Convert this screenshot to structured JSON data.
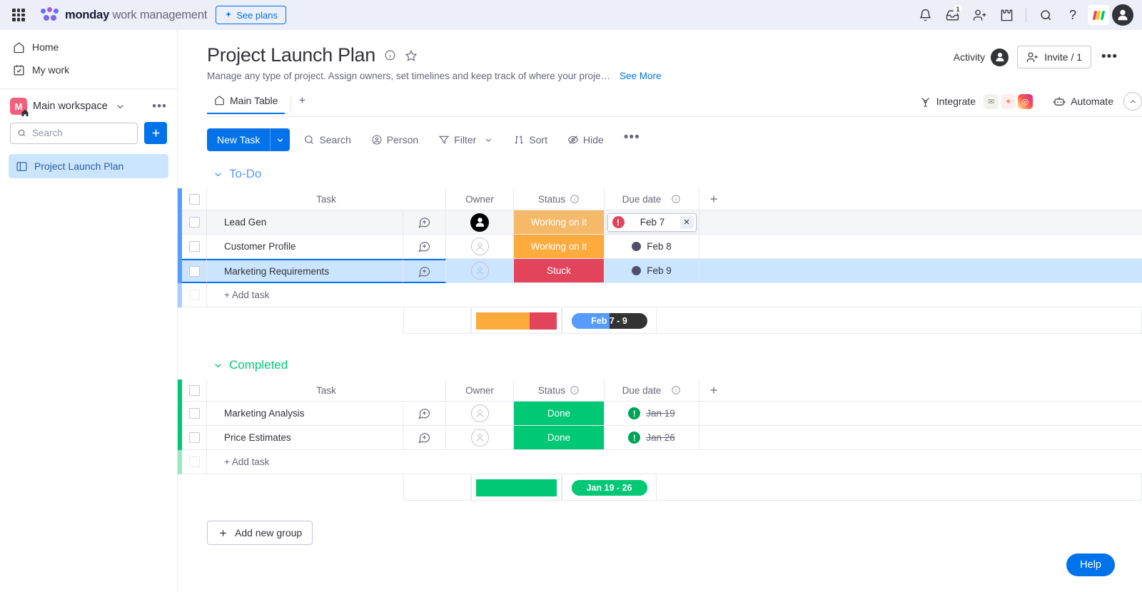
{
  "topbar": {
    "brand_bold": "monday",
    "brand_light": " work management",
    "see_plans": "See plans",
    "inbox_badge": "1",
    "icons": [
      "apps-grid-icon",
      "notifications-bell-icon",
      "inbox-icon",
      "invite-member-icon",
      "apps-puzzle-icon",
      "search-icon",
      "help-question-icon",
      "monday-logo-icon",
      "user-avatar-icon"
    ]
  },
  "sidebar": {
    "links": [
      {
        "label": "Home",
        "icon": "home-icon"
      },
      {
        "label": "My work",
        "icon": "my-work-icon"
      }
    ],
    "workspace": {
      "initial": "M",
      "name": "Main workspace"
    },
    "search_placeholder": "Search",
    "search_value": "",
    "add_label": "+",
    "board": {
      "label": "Project Launch Plan",
      "icon": "board-icon"
    }
  },
  "board": {
    "title": "Project Launch Plan",
    "description": "Manage any type of project. Assign owners, set timelines and keep track of where your projec…",
    "see_more": "See More",
    "activity_label": "Activity",
    "invite_label": "Invite / 1",
    "tabs": [
      {
        "label": "Main Table",
        "icon": "home-icon"
      }
    ],
    "tab_add": "+",
    "integrate_label": "Integrate",
    "automate_label": "Automate"
  },
  "toolbar": {
    "new_task": "New Task",
    "items": [
      {
        "label": "Search",
        "icon": "search-icon"
      },
      {
        "label": "Person",
        "icon": "person-icon"
      },
      {
        "label": "Filter",
        "icon": "filter-icon",
        "caret": true
      },
      {
        "label": "Sort",
        "icon": "sort-icon"
      },
      {
        "label": "Hide",
        "icon": "hide-eye-icon"
      }
    ],
    "more": "…"
  },
  "columns": {
    "task": "Task",
    "owner": "Owner",
    "status": "Status",
    "due_date": "Due date",
    "add": "+"
  },
  "groups": [
    {
      "name": "To-Do",
      "color": "#579bfc",
      "rows": [
        {
          "task": "Lead Gen",
          "owner": "filled",
          "status": "Working on it",
          "status_color": "#fdab3d",
          "date": "Feb 7",
          "date_state": "chip",
          "badge": "bang",
          "badge_color": "#e2445c",
          "row_state": "hover"
        },
        {
          "task": "Customer Profile",
          "owner": "empty",
          "status": "Working on it",
          "status_color": "#fdab3d",
          "date": "Feb 8",
          "date_state": "plain",
          "badge": "dot",
          "badge_color": "#4f4f6b",
          "row_state": "normal"
        },
        {
          "task": "Marketing Requirements",
          "owner": "empty",
          "status": "Stuck",
          "status_color": "#e2445c",
          "date": "Feb 9",
          "date_state": "plain",
          "badge": "dot",
          "badge_color": "#4f4f6b",
          "row_state": "selected"
        }
      ],
      "add_task": "+ Add task",
      "summary": {
        "status_segments": [
          {
            "color": "#fdab3d",
            "pct": 66.7
          },
          {
            "color": "#e2445c",
            "pct": 33.3
          }
        ],
        "date_label": "Feb 7 - 9",
        "date_bg": "#333333",
        "date_fill": "#579bfc",
        "date_fill_pct": 50
      }
    },
    {
      "name": "Completed",
      "color": "#00c875",
      "rows": [
        {
          "task": "Marketing Analysis",
          "owner": "empty",
          "status": "Done",
          "status_color": "#00c875",
          "date": "Jan 19",
          "date_state": "strike",
          "badge": "bang",
          "badge_color": "#00a358",
          "row_state": "normal"
        },
        {
          "task": "Price Estimates",
          "owner": "empty",
          "status": "Done",
          "status_color": "#00c875",
          "date": "Jan 26",
          "date_state": "strike",
          "badge": "bang",
          "badge_color": "#00a358",
          "row_state": "normal"
        }
      ],
      "add_task": "+ Add task",
      "summary": {
        "status_segments": [
          {
            "color": "#00c875",
            "pct": 100
          }
        ],
        "date_label": "Jan 19 - 26",
        "date_bg": "#00c875",
        "date_fill": "#00c875",
        "date_fill_pct": 100
      }
    }
  ],
  "footer": {
    "add_new_group": "Add new group",
    "help": "Help"
  }
}
